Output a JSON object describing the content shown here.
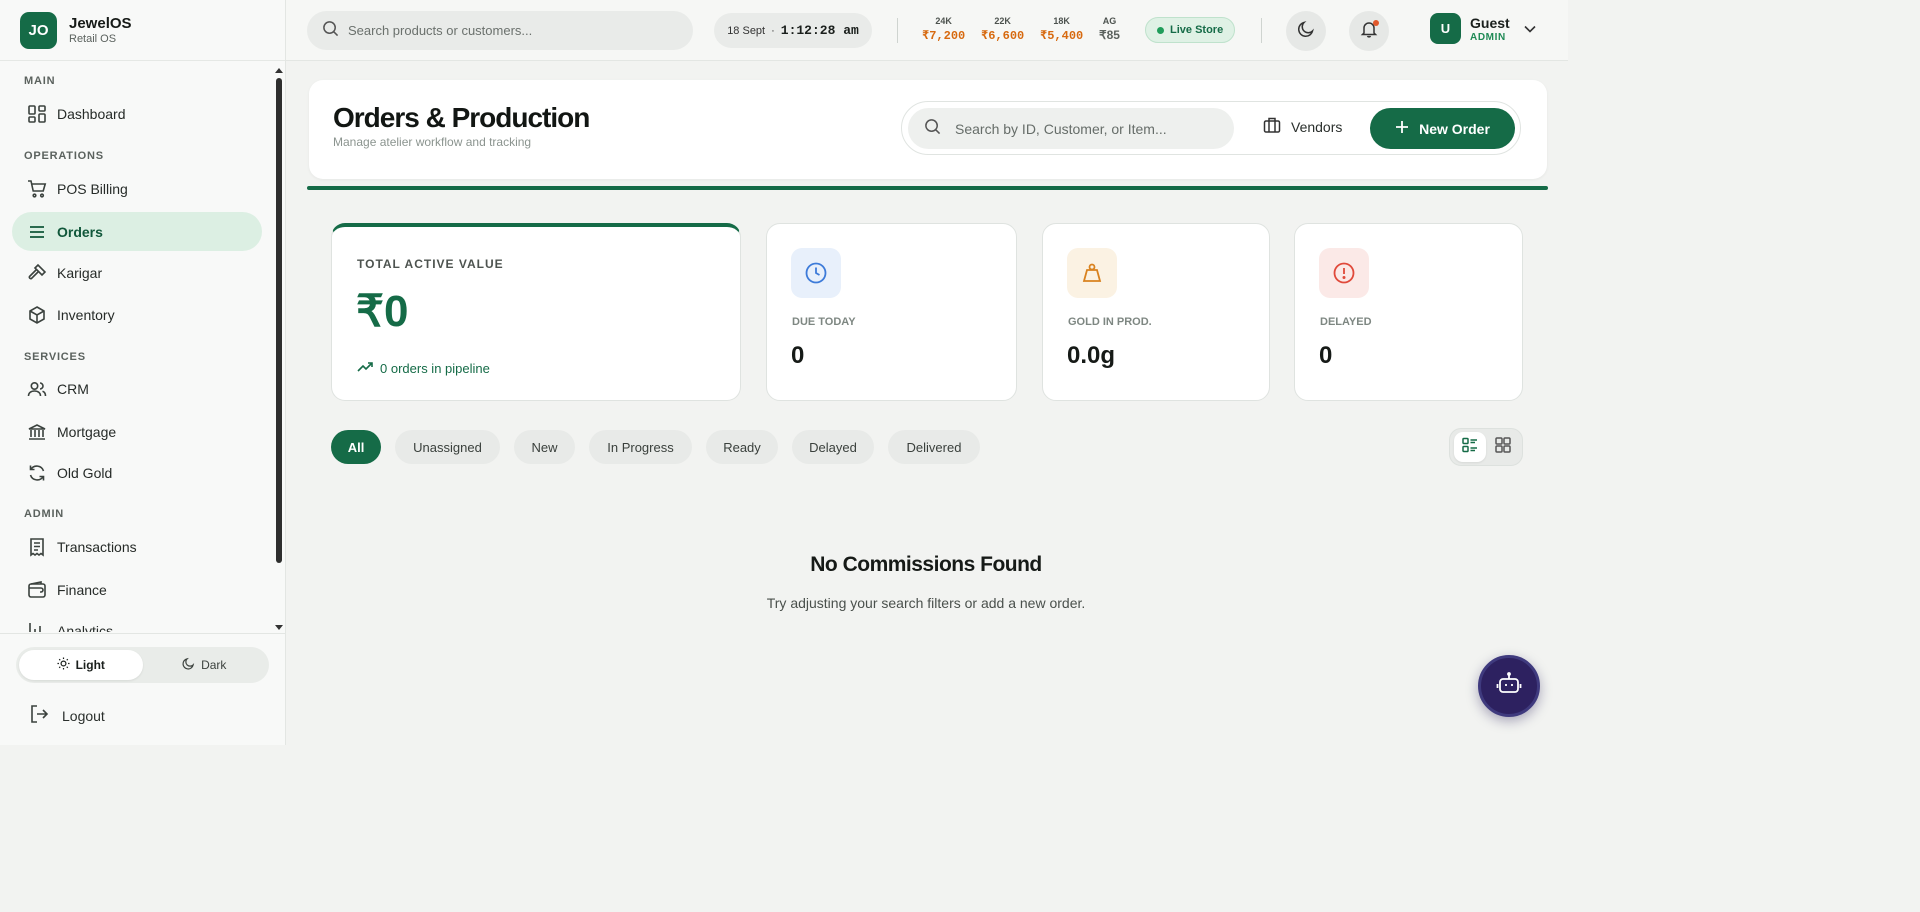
{
  "brand": {
    "logo_initials": "JO",
    "name": "JewelOS",
    "subtitle": "Retail OS"
  },
  "sidebar": {
    "sections": [
      "MAIN",
      "OPERATIONS",
      "SERVICES",
      "ADMIN"
    ],
    "items": [
      {
        "label": "Dashboard",
        "icon": "dashboard-icon",
        "active": false
      },
      {
        "label": "POS Billing",
        "icon": "cart-icon",
        "active": false
      },
      {
        "label": "Orders",
        "icon": "list-icon",
        "active": true
      },
      {
        "label": "Karigar",
        "icon": "hammer-icon",
        "active": false
      },
      {
        "label": "Inventory",
        "icon": "box-icon",
        "active": false
      },
      {
        "label": "CRM",
        "icon": "users-icon",
        "active": false
      },
      {
        "label": "Mortgage",
        "icon": "bank-icon",
        "active": false
      },
      {
        "label": "Old Gold",
        "icon": "refresh-icon",
        "active": false
      },
      {
        "label": "Transactions",
        "icon": "receipt-icon",
        "active": false
      },
      {
        "label": "Finance",
        "icon": "wallet-icon",
        "active": false
      },
      {
        "label": "Analytics",
        "icon": "bar-chart-icon",
        "active": false
      }
    ],
    "theme": {
      "light_label": "Light",
      "dark_label": "Dark",
      "selected": "Light"
    },
    "logout_label": "Logout"
  },
  "topbar": {
    "search_placeholder": "Search products or customers...",
    "date": "18 Sept",
    "separator": "·",
    "time": "1:12:28 am",
    "rates": [
      {
        "karat": "24K",
        "price": "₹7,200"
      },
      {
        "karat": "22K",
        "price": "₹6,600"
      },
      {
        "karat": "18K",
        "price": "₹5,400"
      },
      {
        "karat": "AG",
        "price": "₹85"
      }
    ],
    "live_label": "Live Store",
    "user": {
      "initial": "U",
      "name": "Guest",
      "role": "ADMIN"
    }
  },
  "page": {
    "title": "Orders & Production",
    "subtitle": "Manage atelier workflow and tracking",
    "search_placeholder": "Search by ID, Customer, or Item...",
    "vendors_label": "Vendors",
    "new_order_label": "New Order"
  },
  "stats": {
    "total_label": "TOTAL ACTIVE VALUE",
    "total_value": "₹0",
    "pipeline_text": "0 orders in pipeline",
    "cards": [
      {
        "label": "DUE TODAY",
        "value": "0",
        "icon": "clock-icon",
        "color": "#3d7bd9"
      },
      {
        "label": "GOLD IN PROD.",
        "value": "0.0g",
        "icon": "weight-icon",
        "color": "#d9821f"
      },
      {
        "label": "DELAYED",
        "value": "0",
        "icon": "alert-icon",
        "color": "#e0493a"
      }
    ]
  },
  "filters": [
    "All",
    "Unassigned",
    "New",
    "In Progress",
    "Ready",
    "Delayed",
    "Delivered"
  ],
  "active_filter": "All",
  "empty_state": {
    "title": "No Commissions Found",
    "message": "Try adjusting your search filters or add a new order."
  },
  "colors": {
    "primary": "#156b47",
    "accent_rate": "#d76a10",
    "active_bg": "#dcefe3"
  }
}
